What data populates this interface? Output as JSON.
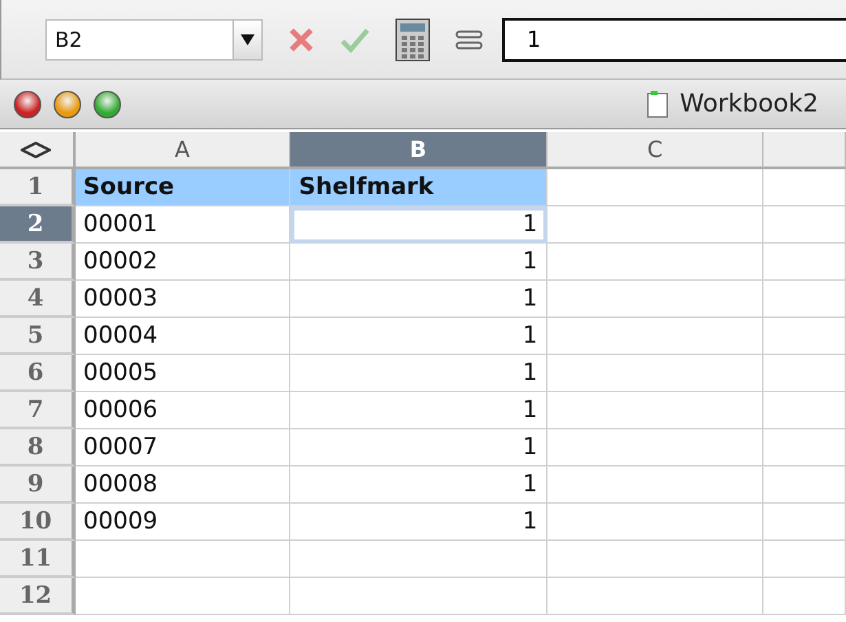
{
  "formula_bar": {
    "name_box": "B2",
    "formula": "1"
  },
  "window": {
    "title": "Workbook2"
  },
  "columns": [
    {
      "label": "A",
      "selected": false
    },
    {
      "label": "B",
      "selected": true
    },
    {
      "label": "C",
      "selected": false
    }
  ],
  "rows": [
    {
      "label": "1",
      "selected": false,
      "highlighted": true,
      "cells": [
        {
          "text": "Source",
          "kind": "text",
          "active": false
        },
        {
          "text": "Shelfmark",
          "kind": "text",
          "active": false
        }
      ]
    },
    {
      "label": "2",
      "selected": true,
      "highlighted": false,
      "cells": [
        {
          "text": "00001",
          "kind": "text",
          "active": false
        },
        {
          "text": "1",
          "kind": "number",
          "active": true
        }
      ]
    },
    {
      "label": "3",
      "selected": false,
      "highlighted": false,
      "cells": [
        {
          "text": "00002",
          "kind": "text",
          "active": false
        },
        {
          "text": "1",
          "kind": "number",
          "active": false
        }
      ]
    },
    {
      "label": "4",
      "selected": false,
      "highlighted": false,
      "cells": [
        {
          "text": "00003",
          "kind": "text",
          "active": false
        },
        {
          "text": "1",
          "kind": "number",
          "active": false
        }
      ]
    },
    {
      "label": "5",
      "selected": false,
      "highlighted": false,
      "cells": [
        {
          "text": "00004",
          "kind": "text",
          "active": false
        },
        {
          "text": "1",
          "kind": "number",
          "active": false
        }
      ]
    },
    {
      "label": "6",
      "selected": false,
      "highlighted": false,
      "cells": [
        {
          "text": "00005",
          "kind": "text",
          "active": false
        },
        {
          "text": "1",
          "kind": "number",
          "active": false
        }
      ]
    },
    {
      "label": "7",
      "selected": false,
      "highlighted": false,
      "cells": [
        {
          "text": "00006",
          "kind": "text",
          "active": false
        },
        {
          "text": "1",
          "kind": "number",
          "active": false
        }
      ]
    },
    {
      "label": "8",
      "selected": false,
      "highlighted": false,
      "cells": [
        {
          "text": "00007",
          "kind": "text",
          "active": false
        },
        {
          "text": "1",
          "kind": "number",
          "active": false
        }
      ]
    },
    {
      "label": "9",
      "selected": false,
      "highlighted": false,
      "cells": [
        {
          "text": "00008",
          "kind": "text",
          "active": false
        },
        {
          "text": "1",
          "kind": "number",
          "active": false
        }
      ]
    },
    {
      "label": "10",
      "selected": false,
      "highlighted": false,
      "cells": [
        {
          "text": "00009",
          "kind": "text",
          "active": false
        },
        {
          "text": "1",
          "kind": "number",
          "active": false
        }
      ]
    },
    {
      "label": "11",
      "selected": false,
      "highlighted": false,
      "cells": []
    },
    {
      "label": "12",
      "selected": false,
      "highlighted": false,
      "cells": []
    }
  ]
}
